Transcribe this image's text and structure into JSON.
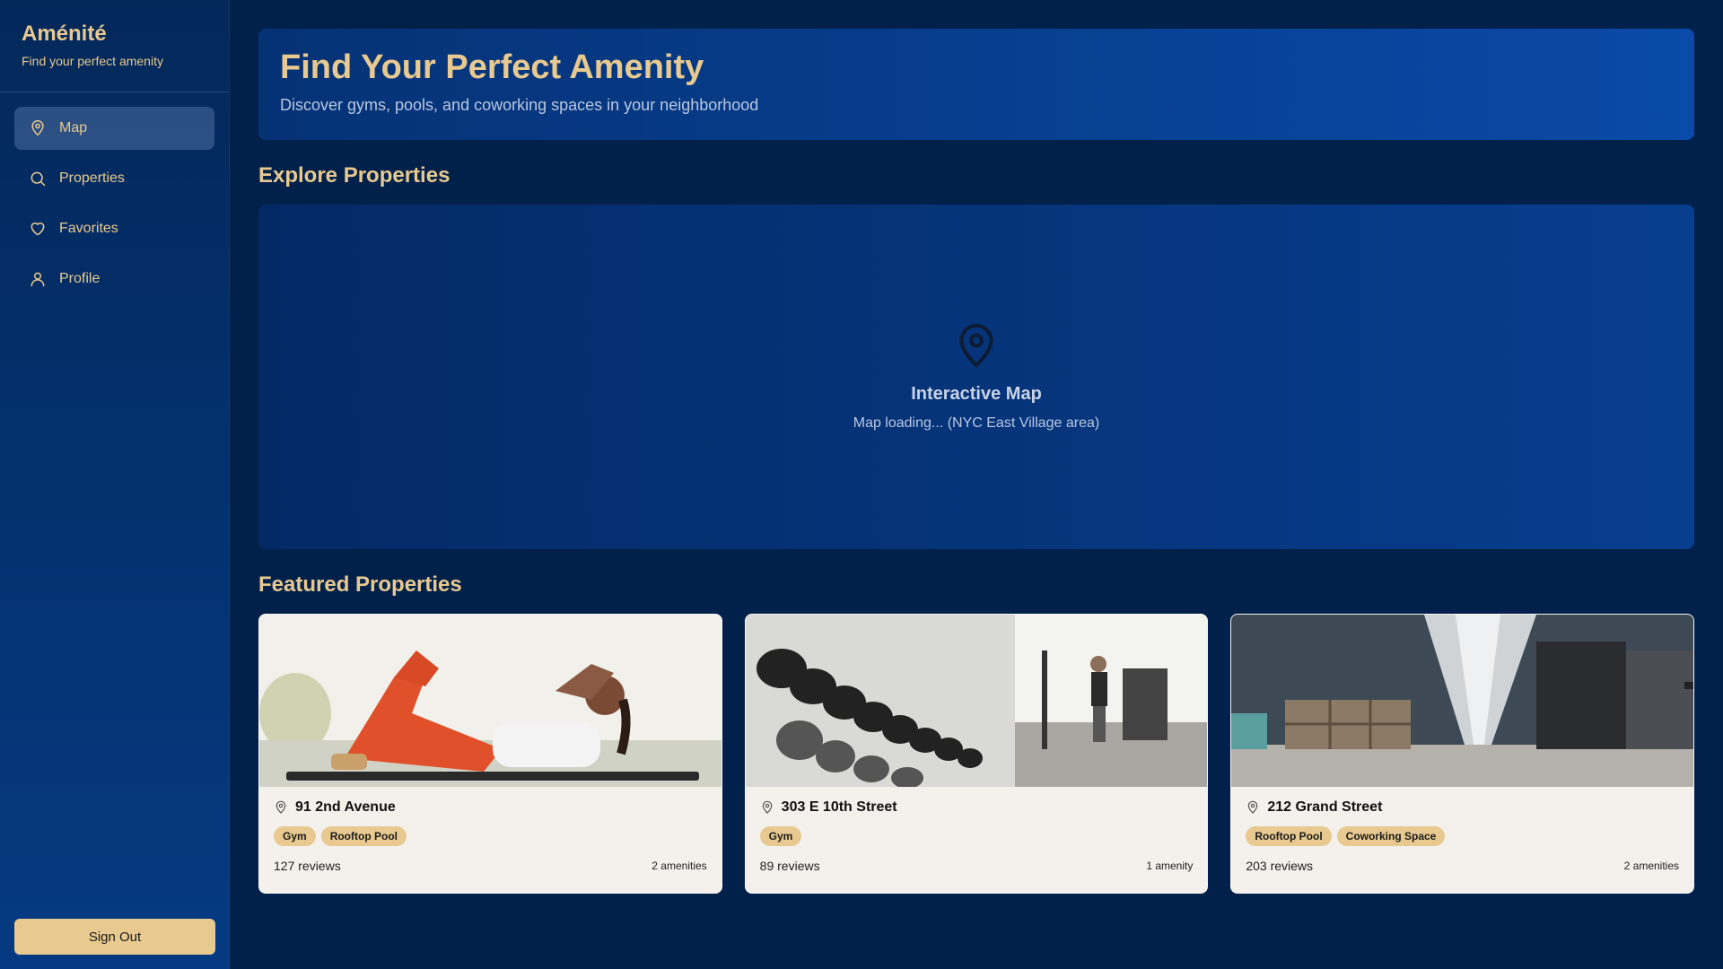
{
  "brand": {
    "title": "Aménité",
    "subtitle": "Find your perfect amenity"
  },
  "nav": [
    {
      "label": "Map",
      "icon": "map-pin-icon",
      "active": true
    },
    {
      "label": "Properties",
      "icon": "search-icon",
      "active": false
    },
    {
      "label": "Favorites",
      "icon": "heart-icon",
      "active": false
    },
    {
      "label": "Profile",
      "icon": "user-icon",
      "active": false
    }
  ],
  "signout_label": "Sign Out",
  "hero": {
    "title": "Find Your Perfect Amenity",
    "subtitle": "Discover gyms, pools, and coworking spaces in your neighborhood"
  },
  "explore": {
    "title": "Explore Properties",
    "map_title": "Interactive Map",
    "map_status": "Map loading... (NYC East Village area)"
  },
  "featured": {
    "title": "Featured Properties",
    "cards": [
      {
        "address": "91 2nd Avenue",
        "tags": [
          "Gym",
          "Rooftop Pool"
        ],
        "reviews": "127 reviews",
        "amenities": "2 amenities",
        "image": "woman-doing-crunches-photo"
      },
      {
        "address": "303 E 10th Street",
        "tags": [
          "Gym"
        ],
        "reviews": "89 reviews",
        "amenities": "1 amenity",
        "image": "dumbbell-rack-gym-photo"
      },
      {
        "address": "212 Grand Street",
        "tags": [
          "Rooftop Pool",
          "Coworking Space"
        ],
        "reviews": "203 reviews",
        "amenities": "2 amenities",
        "image": "coworking-office-hallway-photo"
      }
    ]
  },
  "colors": {
    "accent": "#e8c98f",
    "background": "#02214a",
    "card": "#f4f0eb"
  }
}
